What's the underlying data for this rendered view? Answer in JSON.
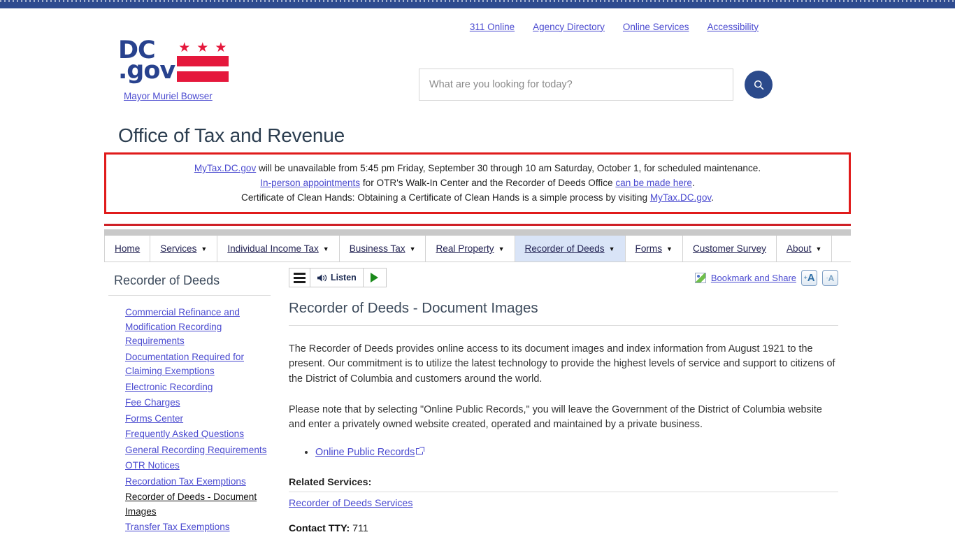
{
  "utility_links": [
    {
      "label": "311 Online"
    },
    {
      "label": "Agency Directory"
    },
    {
      "label": "Online Services"
    },
    {
      "label": "Accessibility"
    }
  ],
  "logo": {
    "line1": "DC",
    "line2": ".gov",
    "star": "★",
    "mayor_link": "Mayor Muriel Bowser"
  },
  "search": {
    "placeholder": "What are you looking for today?",
    "value": "",
    "button_icon": "search-icon"
  },
  "agency_title": "Office of Tax and Revenue",
  "alert": {
    "line1_link": "MyTax.DC.gov",
    "line1_rest": " will be unavailable from 5:45 pm Friday, September 30 through 10 am Saturday, October 1, for scheduled maintenance.",
    "line2_link1": "In-person appointments",
    "line2_mid": " for OTR's Walk-In Center and the Recorder of Deeds Office ",
    "line2_link2": "can be made here",
    "line2_end": ".",
    "line3_pre": "Certificate of Clean Hands: Obtaining a Certificate of Clean Hands is a simple process by visiting ",
    "line3_link": "MyTax.DC.gov",
    "line3_end": ".",
    "border_color": "#e01b1b"
  },
  "nav": [
    {
      "label": "Home",
      "has_caret": false,
      "active": false
    },
    {
      "label": "Services",
      "has_caret": true,
      "active": false
    },
    {
      "label": "Individual Income Tax",
      "has_caret": true,
      "active": false
    },
    {
      "label": "Business Tax",
      "has_caret": true,
      "active": false
    },
    {
      "label": "Real Property",
      "has_caret": true,
      "active": false
    },
    {
      "label": "Recorder of Deeds",
      "has_caret": true,
      "active": true
    },
    {
      "label": "Forms",
      "has_caret": true,
      "active": false
    },
    {
      "label": "Customer Survey",
      "has_caret": false,
      "active": false
    },
    {
      "label": "About",
      "has_caret": true,
      "active": false
    }
  ],
  "sidebar": {
    "title": "Recorder of Deeds",
    "items": [
      {
        "label": "Commercial Refinance and Modification Recording Requirements",
        "current": false
      },
      {
        "label": "Documentation Required for Claiming Exemptions",
        "current": false
      },
      {
        "label": "Electronic Recording",
        "current": false
      },
      {
        "label": "Fee Charges",
        "current": false
      },
      {
        "label": "Forms Center",
        "current": false
      },
      {
        "label": "Frequently Asked Questions",
        "current": false
      },
      {
        "label": "General Recording Requirements",
        "current": false
      },
      {
        "label": "OTR Notices",
        "current": false
      },
      {
        "label": "Recordation Tax Exemptions",
        "current": false
      },
      {
        "label": "Recorder of Deeds - Document Images",
        "current": true
      },
      {
        "label": "Transfer Tax Exemptions",
        "current": false
      }
    ]
  },
  "tools": {
    "listen_label": "Listen",
    "menu_icon": "hamburger-menu-icon",
    "speaker_icon": "speaker-icon",
    "play_icon": "play-triangle-icon",
    "share_label": "Bookmark and Share",
    "font_increase": "A",
    "font_increase_sup": "+",
    "font_decrease": "A",
    "font_decrease_sup": "-"
  },
  "main": {
    "heading": "Recorder of Deeds - Document Images",
    "para1": "The Recorder of Deeds provides online access to its document images and index information from August 1921 to the present. Our commitment is to utilize the latest technology to provide the highest levels of service and support to citizens of the District of Columbia and customers around the world.",
    "para2": "Please note that by selecting \"Online Public Records,\" you will leave the Government of the District of Columbia website and enter a privately owned website created, operated and maintained by a private business.",
    "bullets": [
      {
        "label": "Online Public Records",
        "external": true
      }
    ],
    "related_title": "Related Services:",
    "related_link": "Recorder of Deeds Services",
    "contact_label": "Contact TTY:",
    "contact_value": "711"
  }
}
